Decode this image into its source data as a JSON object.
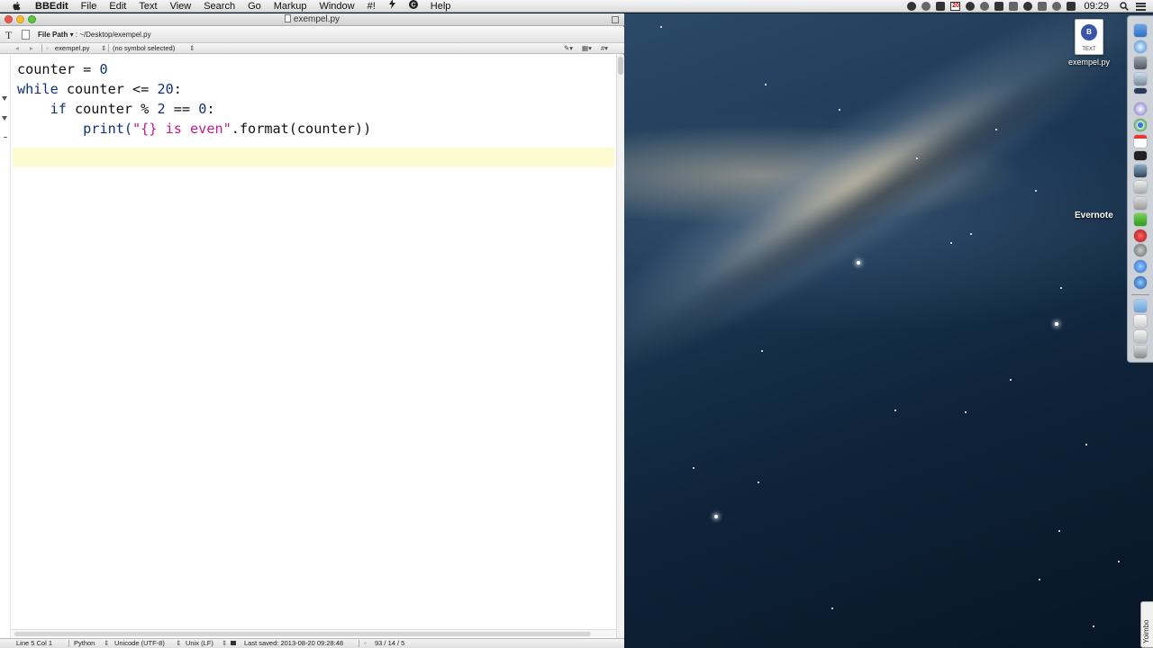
{
  "menubar": {
    "app_name": "BBEdit",
    "items": [
      "File",
      "Edit",
      "Text",
      "View",
      "Search",
      "Go",
      "Markup",
      "Window",
      "#!",
      "Help"
    ],
    "calendar_day": "20",
    "clock": "09:29"
  },
  "window": {
    "title": "exempel.py"
  },
  "pathbar": {
    "label": "File Path",
    "path": ": ~/Desktop/exempel.py"
  },
  "navbar": {
    "file": "exempel.py",
    "symbol": "(no symbol selected)"
  },
  "code_lines": [
    "counter = 0",
    "while counter <= 20:",
    "    if counter % 2 == 0:",
    "        print(\"{} is even\".format(counter))"
  ],
  "code_tokens": {
    "l1_name": "counter",
    "l1_op": " = ",
    "l1_num": "0",
    "l2_kw": "while",
    "l2_rest": " counter <= ",
    "l2_num": "20",
    "l2_colon": ":",
    "l3_indent": "    ",
    "l3_kw": "if",
    "l3_rest": " counter % ",
    "l3_num1": "2",
    "l3_op": " == ",
    "l3_num2": "0",
    "l3_colon": ":",
    "l4_indent": "        ",
    "l4_call": "print(",
    "l4_str": "\"{} is even\"",
    "l4_rest": ".format(counter))"
  },
  "statusbar": {
    "position": "Line 5 Col 1",
    "language": "Python",
    "encoding": "Unicode (UTF-8)",
    "line_endings": "Unix (LF)",
    "last_saved": "Last saved: 2013-08-20 09:28:48",
    "counts": "93 / 14 / 5"
  },
  "desktop": {
    "file_name": "exempel.py",
    "file_kind": "TEXT",
    "tooltip": "Evernote",
    "side_tab": "Yoimbo"
  },
  "colors": {
    "keyword": "#10317a",
    "string": "#c5198c",
    "current_line": "#fdfbd2"
  }
}
